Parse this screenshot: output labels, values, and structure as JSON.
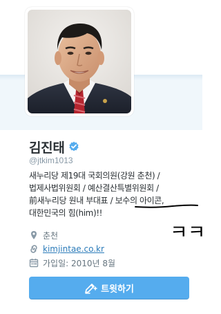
{
  "profile": {
    "name": "김진태",
    "handle": "@jtkim1013",
    "bio_lines": [
      "새누리당 제19대 국회의원(강원 춘천) /",
      "법제사법위원회 / 예산결산특별위원회 /",
      "前새누리당 원내 부대표 / 보수의 아이콘,",
      "대한민국의 힘(him)!!"
    ],
    "location": "춘천",
    "website": "kimjintae.co.kr",
    "joined": "가입일: 2010년 8월",
    "verified_icon": "verified-badge-icon"
  },
  "annotation": {
    "handwritten_text": "ㅋㅋ"
  },
  "actions": {
    "tweet_label": "트윗하기",
    "tweet_icon": "compose-icon"
  },
  "colors": {
    "accent": "#55acee",
    "link": "#2b7bb9",
    "verified": "#55acee",
    "header_band": "#f0f7fb"
  }
}
